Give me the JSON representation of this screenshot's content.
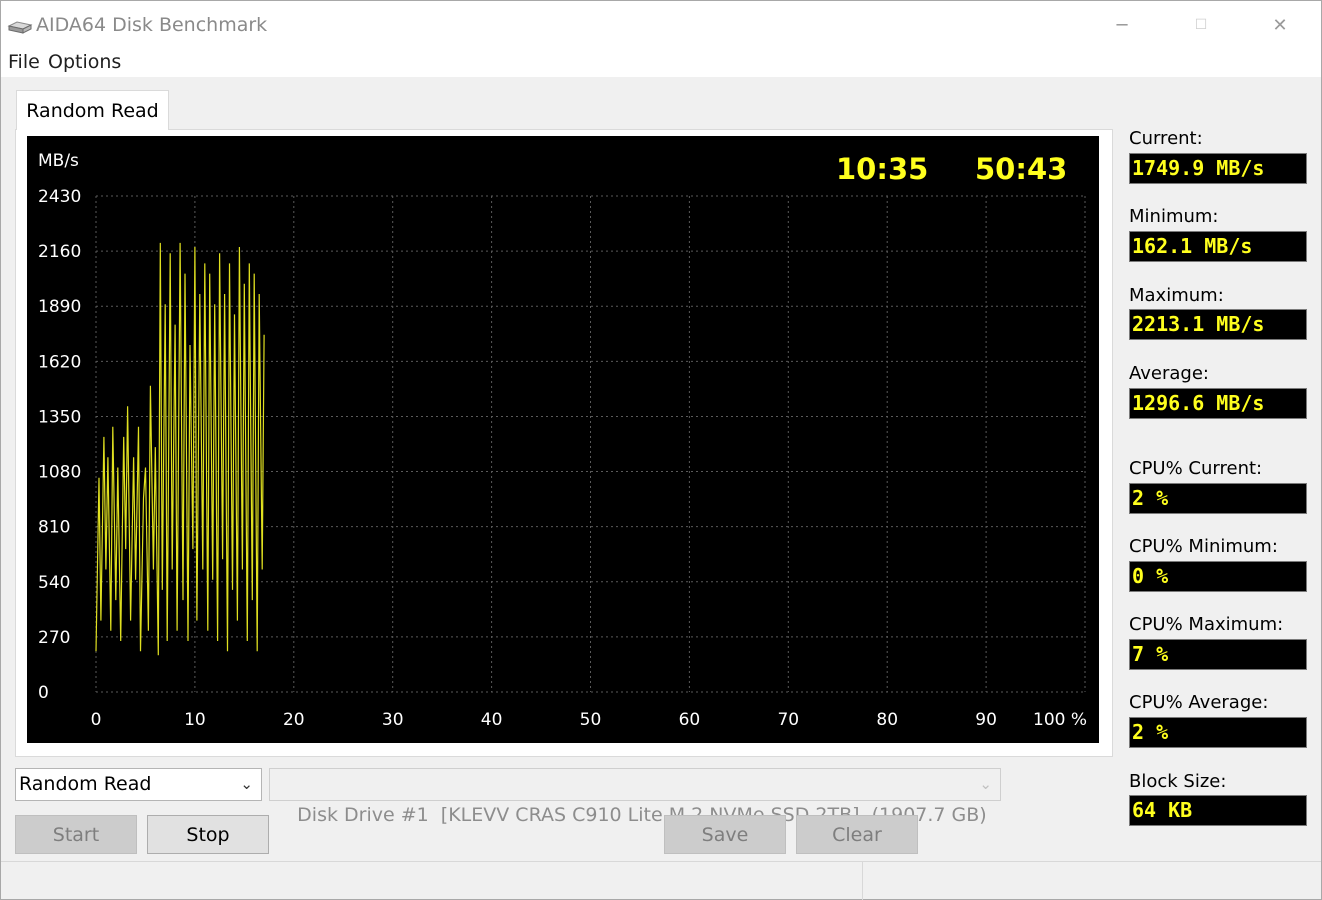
{
  "window": {
    "title": "AIDA64 Disk Benchmark",
    "controls": {
      "minimize": "─",
      "maximize": "☐",
      "close": "✕"
    }
  },
  "menu": {
    "file": "File",
    "options": "Options"
  },
  "tab": {
    "label": "Random Read"
  },
  "chart_data": {
    "type": "line",
    "ylabel": "MB/s",
    "y_ticks": [
      0,
      270,
      540,
      810,
      1080,
      1350,
      1620,
      1890,
      2160,
      2430
    ],
    "x_ticks": [
      "0",
      "10",
      "20",
      "30",
      "40",
      "50",
      "60",
      "70",
      "80",
      "90",
      "100 %"
    ],
    "xlim": [
      0,
      100
    ],
    "ylim": [
      0,
      2430
    ],
    "grid": true,
    "line_color": "#e0e020",
    "elapsed_time": "10:35",
    "remaining_time": "50:43",
    "series": [
      {
        "x": [
          0,
          0.3,
          0.5,
          0.8,
          1,
          1.2,
          1.5,
          1.7,
          2,
          2.2,
          2.5,
          2.8,
          3,
          3.2,
          3.5,
          3.8,
          4,
          4.3,
          4.5,
          4.8,
          5,
          5.3,
          5.5,
          5.8,
          6,
          6.3,
          6.5,
          6.7,
          7,
          7.2,
          7.5,
          7.7,
          8,
          8.2,
          8.5,
          8.8,
          9,
          9.3,
          9.5,
          9.8,
          10,
          10.2,
          10.5,
          10.8,
          11,
          11.3,
          11.5,
          11.8,
          12,
          12.3,
          12.5,
          12.8,
          13,
          13.3,
          13.5,
          13.8,
          14,
          14.3,
          14.5,
          14.8,
          15,
          15.3,
          15.5,
          15.8,
          16,
          16.3,
          16.5,
          16.8,
          17
        ],
        "values": [
          200,
          1050,
          350,
          1250,
          600,
          1150,
          300,
          1300,
          450,
          1100,
          250,
          1250,
          700,
          1400,
          350,
          1150,
          550,
          1300,
          200,
          950,
          1100,
          300,
          1500,
          600,
          1200,
          180,
          2200,
          500,
          1900,
          250,
          2150,
          600,
          1800,
          300,
          2200,
          450,
          2050,
          250,
          1700,
          700,
          2180,
          350,
          1950,
          600,
          2100,
          300,
          2050,
          550,
          1900,
          250,
          2150,
          650,
          1950,
          200,
          2100,
          500,
          1850,
          350,
          2180,
          600,
          2000,
          250,
          2100,
          450,
          2050,
          200,
          1950,
          600,
          1750
        ]
      }
    ]
  },
  "stats": {
    "current": {
      "label": "Current:",
      "value": "1749.9 MB/s"
    },
    "minimum": {
      "label": "Minimum:",
      "value": "162.1 MB/s"
    },
    "maximum": {
      "label": "Maximum:",
      "value": "2213.1 MB/s"
    },
    "average": {
      "label": "Average:",
      "value": "1296.6 MB/s"
    },
    "cpu_current": {
      "label": "CPU% Current:",
      "value": "2 %"
    },
    "cpu_minimum": {
      "label": "CPU% Minimum:",
      "value": "0 %"
    },
    "cpu_maximum": {
      "label": "CPU% Maximum:",
      "value": "7 %"
    },
    "cpu_average": {
      "label": "CPU% Average:",
      "value": "2 %"
    },
    "block_size": {
      "label": "Block Size:",
      "value": "64 KB"
    }
  },
  "controls": {
    "test_select": "Random Read",
    "drive_select": "Disk Drive #1  [KLEVV CRAS C910 Lite M.2 NVMe SSD 2TB]  (1907.7 GB)",
    "start": "Start",
    "stop": "Stop",
    "save": "Save",
    "clear": "Clear"
  }
}
